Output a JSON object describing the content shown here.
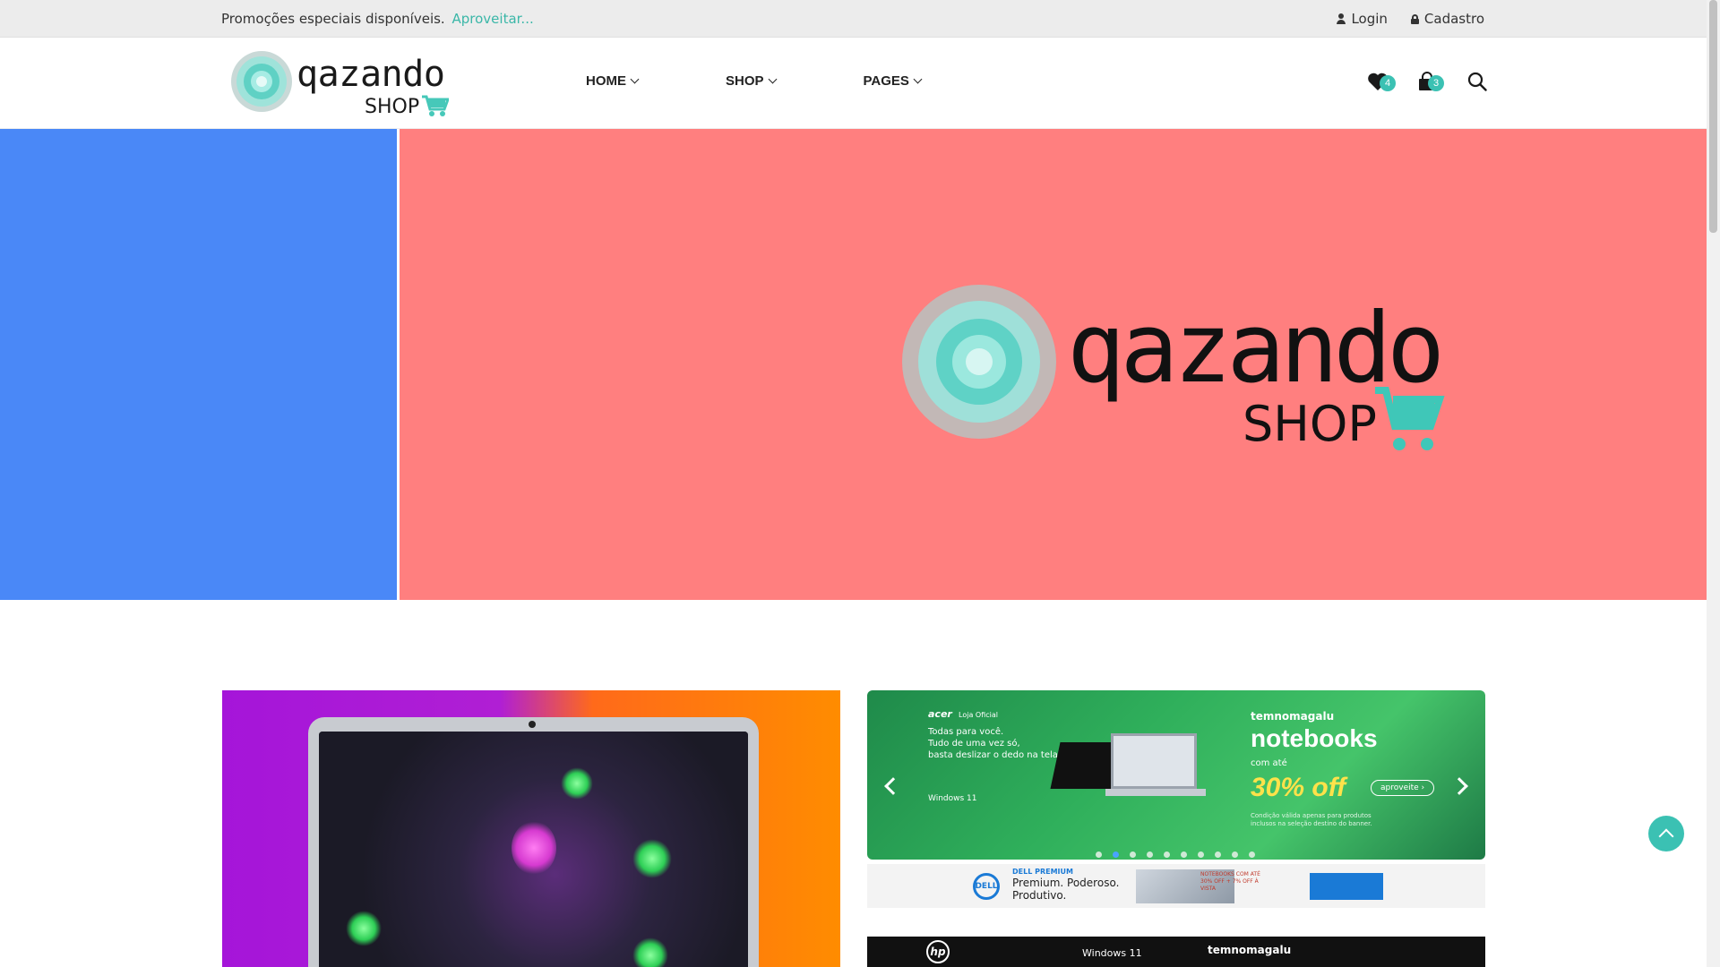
{
  "topbar": {
    "promo_text": "Promoções especiais disponíveis.",
    "promo_link": "Aproveitar...",
    "login": "Login",
    "signup": "Cadastro"
  },
  "header": {
    "logo_word": "qazando",
    "logo_sub": "SHOP",
    "nav": [
      {
        "label": "HOME"
      },
      {
        "label": "SHOP"
      },
      {
        "label": "PAGES"
      }
    ],
    "wishlist_count": "4",
    "cart_count": "3"
  },
  "hero": {
    "left_color": "#4a88f7",
    "right_color": "#ff7f7f",
    "logo_word": "qazando",
    "logo_sub": "SHOP"
  },
  "banners": {
    "carousel": {
      "brand": "acer",
      "brand_sub": "Loja Oficial",
      "copy_lines": [
        "Todas para você.",
        "Tudo de uma vez só,",
        "basta deslizar o dedo na tela."
      ],
      "windows": "Windows 11",
      "store": "temnomagalu",
      "headline": "notebooks",
      "prefix": "com até",
      "discount": "30% off",
      "cta": "aproveite ›",
      "fine_print": "Condição válida apenas para produtos inclusos na seleção destino do banner.",
      "slide_count": 10,
      "active_slide": 1
    },
    "sub_banner": {
      "brand": "DELL",
      "headline": "DELL PREMIUM",
      "copy": "Premium. Poderoso. Produtivo.",
      "offer": "NOTEBOOKS COM ATÉ 30% OFF + 7% OFF À VISTA"
    },
    "hp_banner": {
      "brand": "hp",
      "windows": "Windows 11",
      "store": "temnomagalu"
    }
  },
  "colors": {
    "accent": "#3bc1b3",
    "link": "#3bb7a8"
  }
}
